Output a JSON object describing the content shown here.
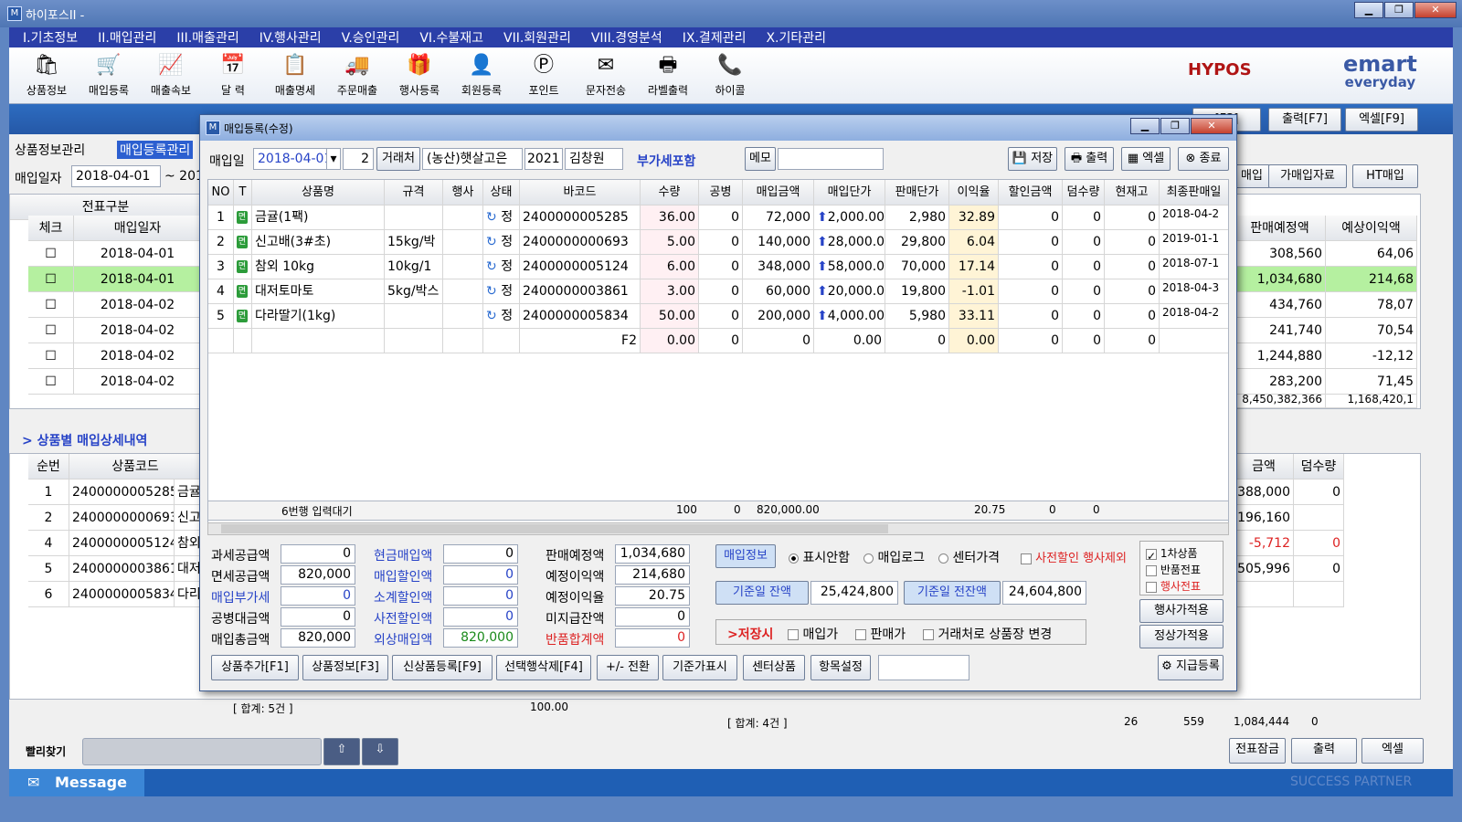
{
  "window": {
    "title": "하이포스II -"
  },
  "menu": [
    "I.기초정보",
    "II.매입관리",
    "III.매출관리",
    "IV.행사관리",
    "V.승인관리",
    "VI.수불재고",
    "VII.회원관리",
    "VIII.경영분석",
    "IX.결제관리",
    "X.기타관리"
  ],
  "toolbar": [
    "상품정보",
    "매입등록",
    "매출속보",
    "달  력",
    "매출명세",
    "주문매출",
    "행사등록",
    "회원등록",
    "포인트",
    "문자전송",
    "라벨출력",
    "하이콜"
  ],
  "logos": {
    "hypos": "HYPOS",
    "emart": "emart",
    "emart_sub": "everyday"
  },
  "bg": {
    "tab1": "상품정보관리",
    "tab2": "매입등록관리",
    "date_label": "매입일자",
    "date_from": "2018-04-01",
    "date_sep": "~ 201",
    "btn_f3": "[F3]",
    "btn_print": "출력[F7]",
    "btn_excel": "엑셀[F9]",
    "btn_buy": "매입",
    "btn_fake": "가매입자료",
    "btn_ht": "HT매입",
    "col_slip": "전표구분",
    "col_check": "체크",
    "col_date": "매입일자",
    "col_saleplan": "판매예정액",
    "col_profit": "예상이익액",
    "rows": [
      {
        "date": "2018-04-01",
        "plan": "308,560",
        "profit": "64,06"
      },
      {
        "date": "2018-04-01",
        "plan": "1,034,680",
        "profit": "214,68"
      },
      {
        "date": "2018-04-02",
        "plan": "434,760",
        "profit": "78,07"
      },
      {
        "date": "2018-04-02",
        "plan": "241,740",
        "profit": "70,54"
      },
      {
        "date": "2018-04-02",
        "plan": "1,244,880",
        "profit": "-12,12"
      },
      {
        "date": "2018-04-02",
        "plan": "283,200",
        "profit": "71,45"
      }
    ],
    "total_plan": "8,450,382,366",
    "total_profit": "1,168,420,1",
    "detail_title": "> 상품별 매입상세내역",
    "d_col_seq": "순번",
    "d_col_code": "상품코드",
    "d_col_amt": "금액",
    "d_col_extra": "덤수량",
    "detail_rows": [
      {
        "seq": "1",
        "code": "2400000005285",
        "name": "금귤",
        "amt": "388,000",
        "extra": "0"
      },
      {
        "seq": "2",
        "code": "2400000000693",
        "name": "신고",
        "amt": "196,160",
        "extra": ""
      },
      {
        "seq": "4",
        "code": "2400000005124",
        "name": "참외",
        "amt": "-5,712",
        "extra": "0"
      },
      {
        "seq": "5",
        "code": "2400000003861",
        "name": "대저",
        "amt": "505,996",
        "extra": "0"
      },
      {
        "seq": "6",
        "code": "2400000005834",
        "name": "다리",
        "amt": "",
        "extra": ""
      }
    ],
    "sum_left": "[ 합계: 5건 ]",
    "sum_left_val": "100.00",
    "sum_right": "[ 합계: 4건 ]",
    "sum_r1": "26",
    "sum_r2": "559",
    "sum_r3": "1,084,444",
    "sum_r4": "0",
    "quick_find": "빨리찾기",
    "btn_lock": "전표잠금",
    "btn_print2": "출력",
    "btn_excel2": "엑셀",
    "message": "Message",
    "success": "SUCCESS PARTNER"
  },
  "dialog": {
    "title": "매입등록(수정)",
    "date_label": "매입일",
    "date": "2018-04-01",
    "num": "2",
    "vendor_btn": "거래처",
    "vendor": "(농산)햇살고은",
    "vendor_code": "2021",
    "manager": "김창원",
    "vat": "부가세포함",
    "memo_btn": "메모",
    "save": "저장",
    "print": "출력",
    "excel": "엑셀",
    "close": "종료",
    "headers": [
      "NO",
      "T",
      "상품명",
      "규격",
      "행사",
      "상태",
      "바코드",
      "수량",
      "공병",
      "매입금액",
      "매입단가",
      "판매단가",
      "이익율",
      "할인금액",
      "덤수량",
      "현재고",
      "최종판매일"
    ],
    "rows": [
      {
        "no": "1",
        "name": "금귤(1팩)",
        "spec": "",
        "state": "정",
        "barcode": "2400000005285",
        "qty": "36.00",
        "bottle": "0",
        "amt": "72,000",
        "unit": "2,000.00",
        "sale": "2,980",
        "rate": "32.89",
        "disc": "0",
        "extra": "0",
        "stock": "0",
        "last": "2018-04-2"
      },
      {
        "no": "2",
        "name": "신고배(3#초)",
        "spec": "15kg/박",
        "state": "정",
        "barcode": "2400000000693",
        "qty": "5.00",
        "bottle": "0",
        "amt": "140,000",
        "unit": "28,000.00",
        "sale": "29,800",
        "rate": "6.04",
        "disc": "0",
        "extra": "0",
        "stock": "0",
        "last": "2019-01-1"
      },
      {
        "no": "3",
        "name": "참외 10kg",
        "spec": "10kg/1",
        "state": "정",
        "barcode": "2400000005124",
        "qty": "6.00",
        "bottle": "0",
        "amt": "348,000",
        "unit": "58,000.00",
        "sale": "70,000",
        "rate": "17.14",
        "disc": "0",
        "extra": "0",
        "stock": "0",
        "last": "2018-07-1"
      },
      {
        "no": "4",
        "name": "대저토마토",
        "spec": "5kg/박스",
        "state": "정",
        "barcode": "2400000003861",
        "qty": "3.00",
        "bottle": "0",
        "amt": "60,000",
        "unit": "20,000.00",
        "sale": "19,800",
        "rate": "-1.01",
        "disc": "0",
        "extra": "0",
        "stock": "0",
        "last": "2018-04-3"
      },
      {
        "no": "5",
        "name": "다라딸기(1kg)",
        "spec": "",
        "state": "정",
        "barcode": "2400000005834",
        "qty": "50.00",
        "bottle": "0",
        "amt": "200,000",
        "unit": "4,000.00",
        "sale": "5,980",
        "rate": "33.11",
        "disc": "0",
        "extra": "0",
        "stock": "0",
        "last": "2018-04-2"
      }
    ],
    "new_row": {
      "f2": "F2",
      "qty": "0.00",
      "bottle": "0",
      "amt": "0",
      "unit": "0.00",
      "sale": "0",
      "rate": "0.00",
      "disc": "0",
      "extra": "0",
      "stock": "0"
    },
    "footer": {
      "status": "6번행 입력대기",
      "qty": "100",
      "bottle": "0",
      "amt": "820,000.00",
      "rate": "20.75",
      "disc": "0",
      "extra": "0"
    },
    "summary": {
      "a": [
        [
          "과세공급액",
          "0"
        ],
        [
          "면세공급액",
          "820,000"
        ],
        [
          "매입부가세",
          "0"
        ],
        [
          "공병대금액",
          "0"
        ],
        [
          "매입총금액",
          "820,000"
        ]
      ],
      "b": [
        [
          "현금매입액",
          "0"
        ],
        [
          "매입할인액",
          "0"
        ],
        [
          "소계할인액",
          "0"
        ],
        [
          "사전할인액",
          "0"
        ],
        [
          "외상매입액",
          "820,000"
        ]
      ],
      "c": [
        [
          "판매예정액",
          "1,034,680"
        ],
        [
          "예정이익액",
          "214,680"
        ],
        [
          "예정이익율",
          "20.75"
        ],
        [
          "미지급잔액",
          "0"
        ],
        [
          "반품합계액",
          "0"
        ]
      ]
    },
    "info_btn": "매입정보",
    "opt1": "표시안함",
    "opt2": "매입로그",
    "opt3": "센터가격",
    "pre_disc": "사전할인 행사제외",
    "base_bal_btn": "기준일 잔액",
    "base_bal": "25,424,800",
    "prev_bal_btn": "기준일 전잔액",
    "prev_bal": "24,604,800",
    "save_label": ">저장시",
    "chk_buy": "매입가",
    "chk_sale": "판매가",
    "chk_vendor": "거래처로 상품장 변경",
    "c1": "1차상품",
    "c2": "반품전표",
    "c3": "행사전표",
    "evt_btn": "행사가적용",
    "norm_btn": "정상가적용",
    "bottom_btns": [
      "상품추가[F1]",
      "상품정보[F3]",
      "신상품등록[F9]",
      "선택행삭제[F4]",
      "+/- 전환",
      "기준가표시",
      "센터상품",
      "항목설정"
    ],
    "pay_btn": "지급등록"
  },
  "colors": {
    "accent": "#2b3fa8",
    "highlight": "#b5f0a0",
    "pink": "#fff0f3",
    "orange": "#fff4d6"
  }
}
